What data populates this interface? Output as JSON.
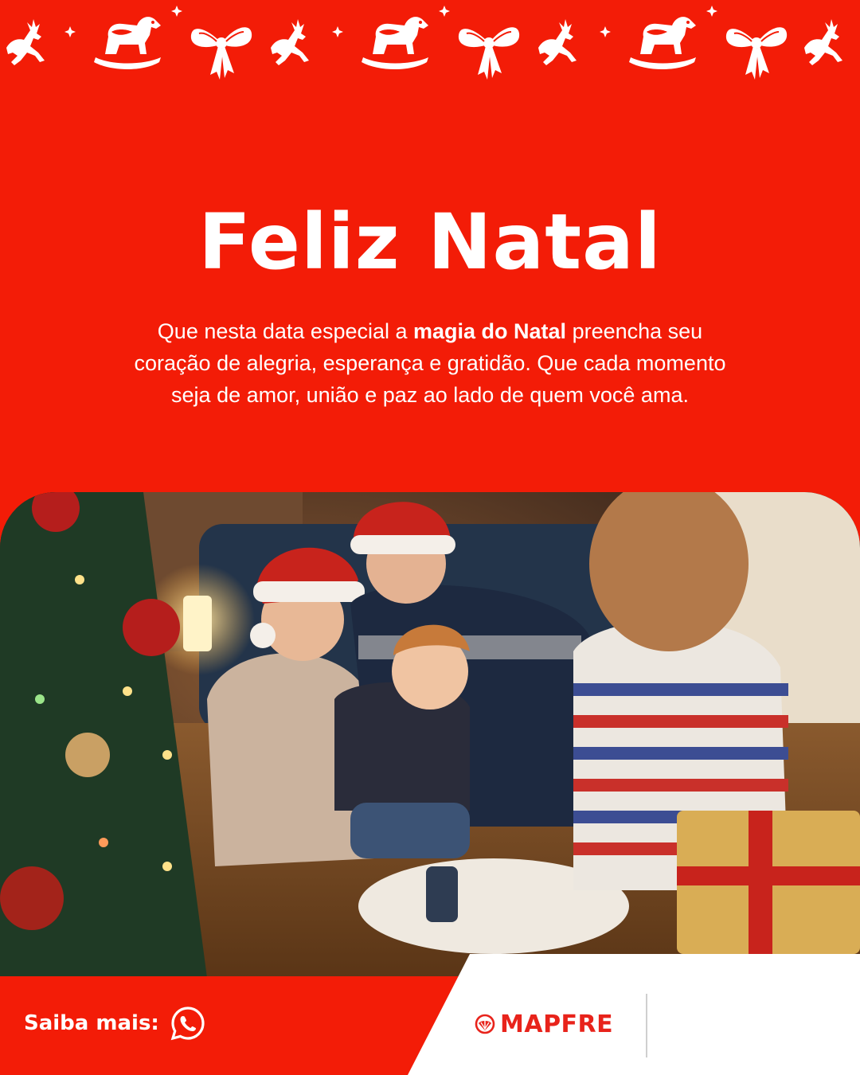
{
  "title": "Feliz Natal",
  "message": {
    "before": "Que nesta data especial a ",
    "bold": "magia do Natal",
    "after": " preencha seu coração de alegria, esperança e gratidão. Que cada momento seja de amor, união e paz ao lado de quem você ama."
  },
  "cta": {
    "label": "Saiba mais:",
    "icon": "whatsapp-icon"
  },
  "brand": {
    "name": "MAPFRE",
    "icon": "mapfre-logo-icon"
  },
  "ornaments": [
    "reindeer-icon",
    "rocking-horse-icon",
    "bow-icon"
  ],
  "colors": {
    "background": "#f31c07",
    "brand_red": "#e8231b",
    "text": "#ffffff",
    "footer_white": "#ffffff"
  }
}
